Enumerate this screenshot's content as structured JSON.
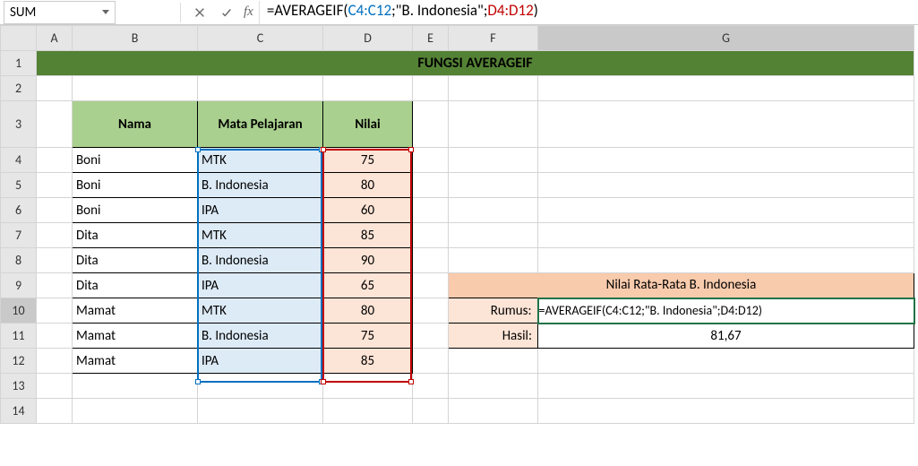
{
  "nameBox": "SUM",
  "formula": {
    "prefix": "=AVERAGEIF(",
    "ref1": "C4:C12",
    "sep1": ";\"B. Indonesia\";",
    "ref2": "D4:D12",
    "suffix": ")"
  },
  "fx": "fx",
  "columns": [
    "A",
    "B",
    "C",
    "D",
    "E",
    "F",
    "G"
  ],
  "rows": [
    "1",
    "2",
    "3",
    "4",
    "5",
    "6",
    "7",
    "8",
    "9",
    "10",
    "11",
    "12",
    "13",
    "14"
  ],
  "title": "FUNGSI AVERAGEIF",
  "headers": {
    "nama": "Nama",
    "mapel": "Mata Pelajaran",
    "nilai": "Nilai"
  },
  "data": [
    {
      "nama": "Boni",
      "mapel": "MTK",
      "nilai": "75"
    },
    {
      "nama": "Boni",
      "mapel": "B. Indonesia",
      "nilai": "80"
    },
    {
      "nama": "Boni",
      "mapel": "IPA",
      "nilai": "60"
    },
    {
      "nama": "Dita",
      "mapel": "MTK",
      "nilai": "85"
    },
    {
      "nama": "Dita",
      "mapel": "B. Indonesia",
      "nilai": "90"
    },
    {
      "nama": "Dita",
      "mapel": "IPA",
      "nilai": "65"
    },
    {
      "nama": "Mamat",
      "mapel": "MTK",
      "nilai": "80"
    },
    {
      "nama": "Mamat",
      "mapel": "B. Indonesia",
      "nilai": "75"
    },
    {
      "nama": "Mamat",
      "mapel": "IPA",
      "nilai": "85"
    }
  ],
  "side": {
    "title": "Nilai Rata-Rata B. Indonesia",
    "rumusLabel": "Rumus:",
    "rumusValue": "=AVERAGEIF(C4:C12;\"B. Indonesia\";D4:D12)",
    "hasilLabel": "Hasil:",
    "hasilValue": "81,67"
  }
}
